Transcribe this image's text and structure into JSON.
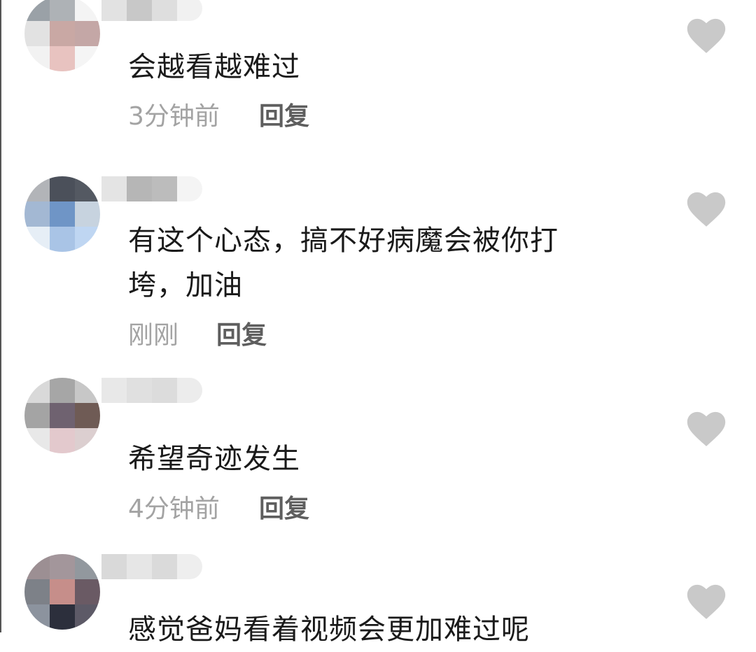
{
  "accent": {
    "like_icon_color": "#c9c9c9",
    "time_color": "#a3a3a3",
    "reply_color": "#5e5e5e"
  },
  "comments": [
    {
      "text": "会越看越难过",
      "time": "3分钟前",
      "reply_label": "回复",
      "like_icon": "heart-icon",
      "avatar_colors": [
        "#9aa1a7",
        "#aeb2b6",
        "#f4f4f4",
        "#e2e2e2",
        "#c9a8a4",
        "#c4a7a6",
        "#f2f2f2",
        "#e8c3c0",
        "#f5f5f5"
      ],
      "username_colors": [
        "#e2e2e2",
        "#c8c8c8",
        "#dedede",
        "#f1f1f1"
      ]
    },
    {
      "text": "有这个心态，搞不好病魔会被你打垮，加油",
      "time": "刚刚",
      "reply_label": "回复",
      "like_icon": "heart-icon",
      "avatar_colors": [
        "#b2b4b8",
        "#4b505a",
        "#545962",
        "#a3b8d3",
        "#6f95c6",
        "#c7d3df",
        "#e6eef6",
        "#a9c4e6",
        "#bfd6f2"
      ],
      "username_colors": [
        "#e4e4e4",
        "#b6b6b6",
        "#bcbcbc",
        "#f4f4f4"
      ]
    },
    {
      "text": "希望奇迹发生",
      "time": "4分钟前",
      "reply_label": "回复",
      "like_icon": "heart-icon",
      "avatar_colors": [
        "#d9d9d9",
        "#a6a6a6",
        "#c7c7c7",
        "#a4a4a4",
        "#6f6270",
        "#6f5b55",
        "#e8e8e8",
        "#e3c9cd",
        "#dccfd0"
      ],
      "username_colors": [
        "#e8e8e8",
        "#e0e0e0",
        "#dcdcdc",
        "#ececec"
      ]
    },
    {
      "text": "感觉爸妈看着视频会更加难过呢",
      "time": "",
      "reply_label": "",
      "like_icon": "heart-icon",
      "avatar_colors": [
        "#9c8f93",
        "#a3969b",
        "#92989e",
        "#7d8188",
        "#c68e8a",
        "#6a5a64",
        "#8c939e",
        "#2c2f3c",
        "#5d5a67"
      ],
      "username_colors": [
        "#d9d9d9",
        "#e6e6e6",
        "#dadada",
        "#eeeeee"
      ]
    }
  ]
}
